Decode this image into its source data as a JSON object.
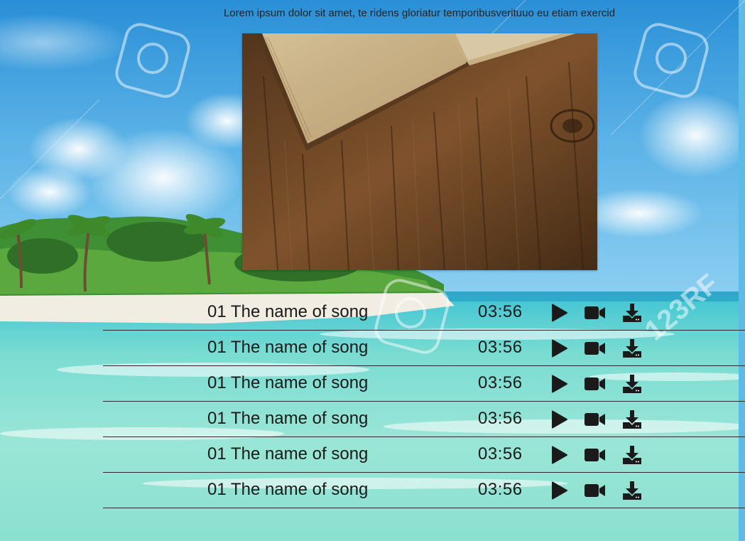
{
  "intro": {
    "text": "Lorem ipsum dolor sit amet, te ridens gloriatur temporibusverituuo eu etiam exercid"
  },
  "background": {
    "watermark": "123RF"
  },
  "colors": {
    "sky": "#3ea0dc",
    "sea": "#5fd2c6",
    "sand": "#f1ece0",
    "text": "#1a1a1a",
    "wood": "#6b4525"
  },
  "tracks": [
    {
      "title": "01 The name of song",
      "duration": "03:56"
    },
    {
      "title": "01 The name of song",
      "duration": "03:56"
    },
    {
      "title": "01 The name of song",
      "duration": "03:56"
    },
    {
      "title": "01 The name of song",
      "duration": "03:56"
    },
    {
      "title": "01 The name of song",
      "duration": "03:56"
    },
    {
      "title": "01 The name of song",
      "duration": "03:56"
    }
  ],
  "icons": {
    "play": "play-icon",
    "video": "video-camera-icon",
    "download": "download-icon"
  }
}
